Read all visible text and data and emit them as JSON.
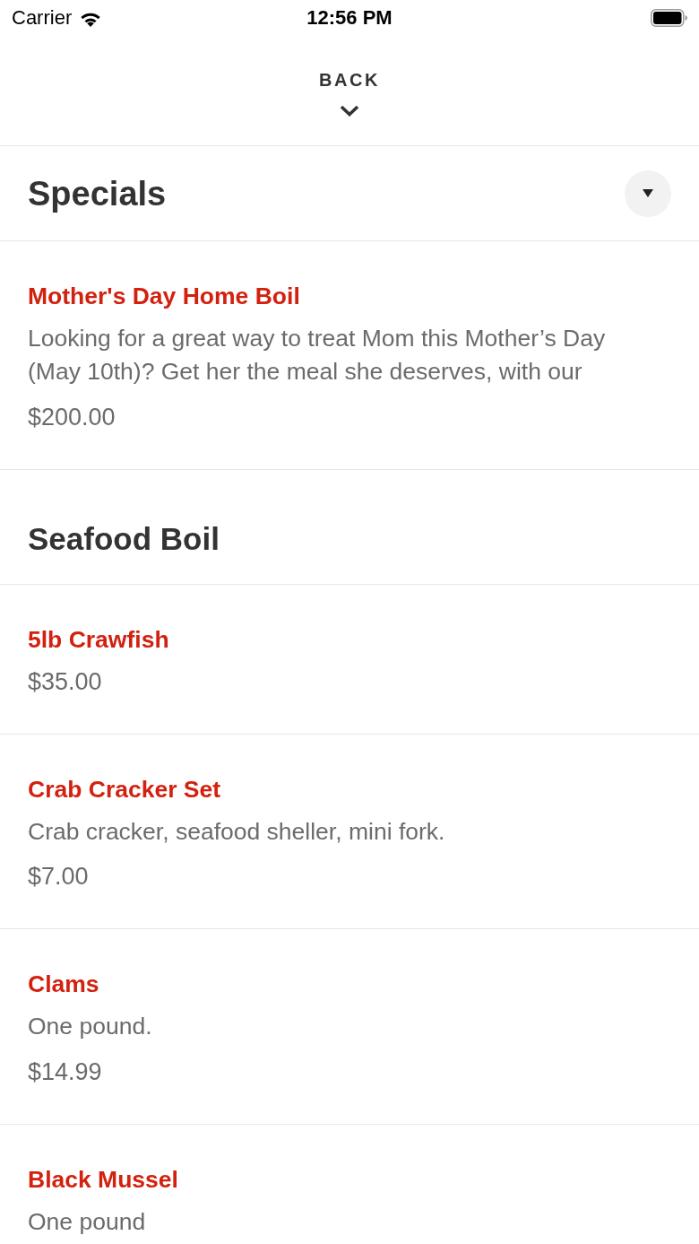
{
  "status_bar": {
    "carrier": "Carrier",
    "time": "12:56 PM"
  },
  "nav": {
    "back_label": "BACK"
  },
  "sections": [
    {
      "title": "Specials",
      "menu_button": true,
      "items": [
        {
          "name": "Mother's Day Home Boil",
          "description": "Looking for a great way to treat Mom this Mother’s Day (May 10th)? Get her the meal she deserves, with our",
          "price": "$200.00"
        }
      ]
    },
    {
      "title": "Seafood Boil",
      "menu_button": false,
      "items": [
        {
          "name": "5lb Crawfish",
          "price": "$35.00"
        },
        {
          "name": "Crab Cracker Set",
          "description": "Crab cracker, seafood sheller, mini fork.",
          "price": "$7.00"
        },
        {
          "name": "Clams",
          "description": "One pound.",
          "price": "$14.99"
        },
        {
          "name": "Black Mussel",
          "description": "One pound"
        }
      ]
    }
  ]
}
